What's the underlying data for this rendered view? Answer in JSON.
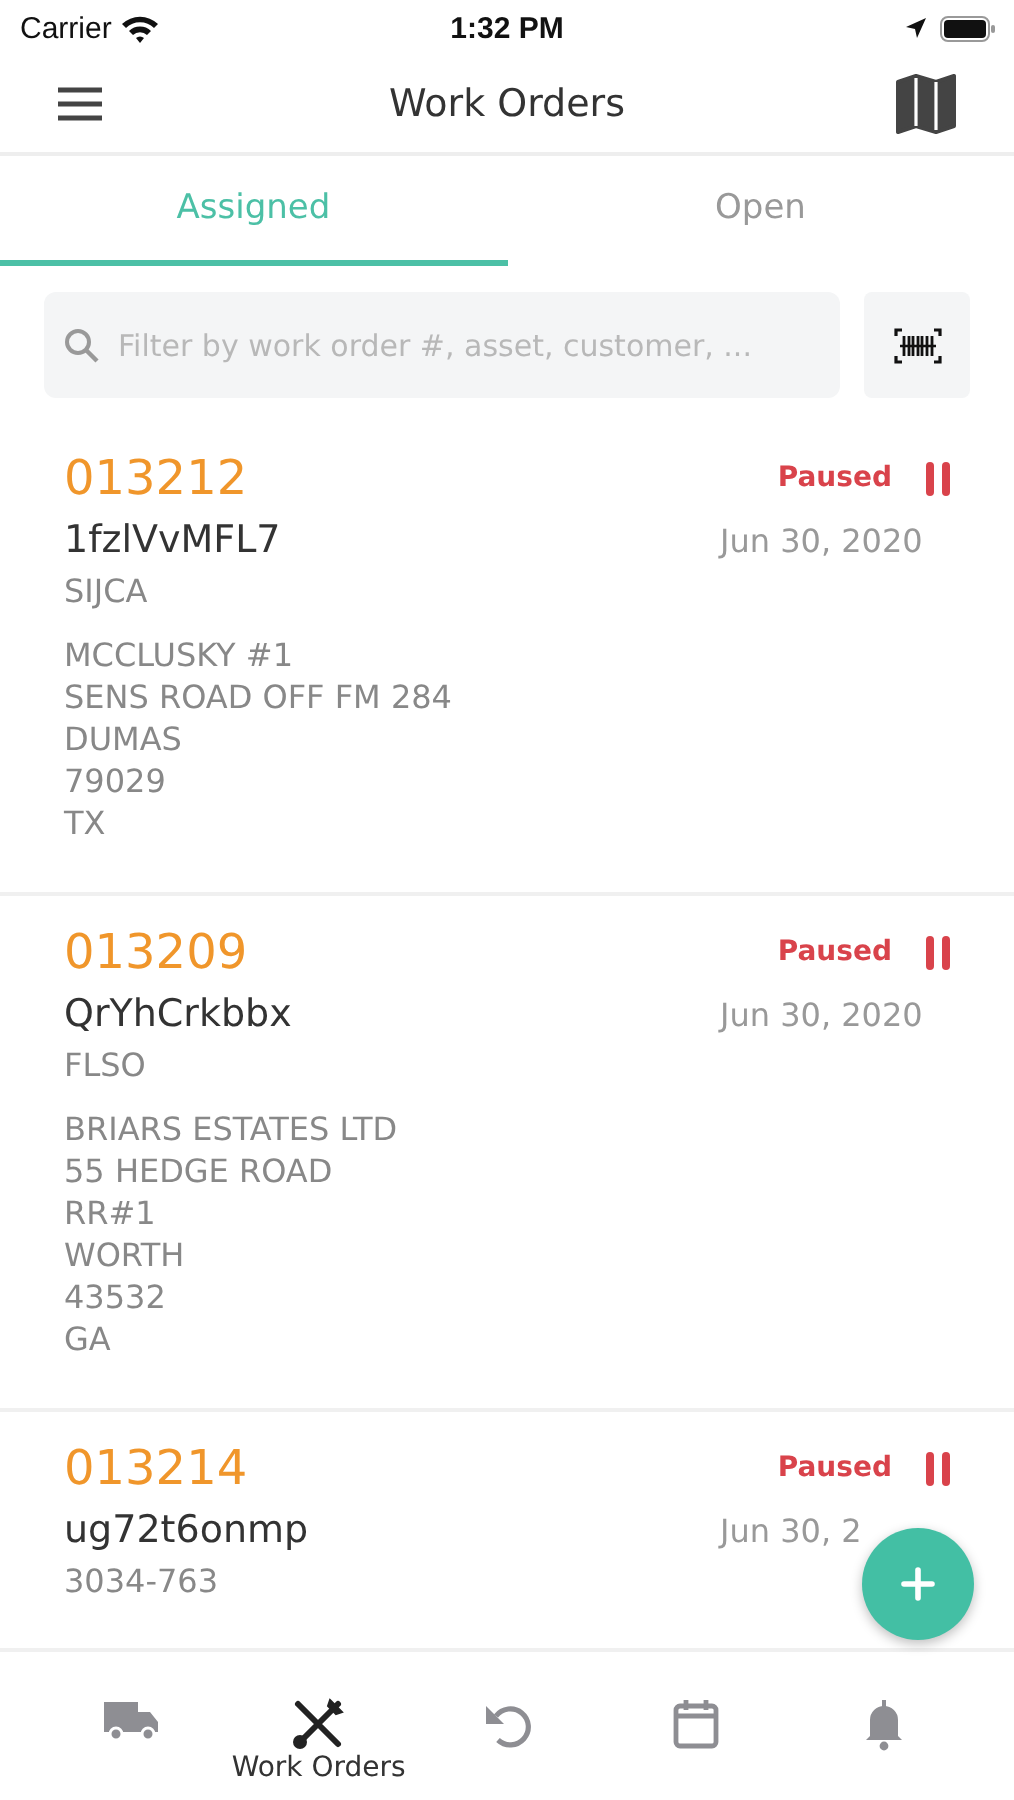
{
  "status_bar": {
    "carrier": "Carrier",
    "time": "1:32 PM"
  },
  "header": {
    "title": "Work Orders"
  },
  "tabs": [
    {
      "label": "Assigned",
      "selected": true
    },
    {
      "label": "Open",
      "selected": false
    }
  ],
  "search": {
    "placeholder": "Filter by work order #, asset, customer, ..."
  },
  "orders": [
    {
      "number": "013212",
      "status": "Paused",
      "paused": true,
      "asset": "1fzlVvMFL7",
      "date": "Jun 30, 2020",
      "customer": "SIJCA",
      "address": [
        "MCCLUSKY #1",
        "SENS ROAD OFF FM 284",
        "DUMAS",
        "79029",
        "TX"
      ]
    },
    {
      "number": "013209",
      "status": "Paused",
      "paused": true,
      "asset": "QrYhCrkbbx",
      "date": "Jun 30, 2020",
      "customer": "FLSO",
      "address": [
        "BRIARS ESTATES LTD",
        "55 HEDGE ROAD",
        "RR#1",
        "WORTH",
        "43532",
        "GA"
      ]
    },
    {
      "number": "013214",
      "status": "Paused",
      "paused": true,
      "asset": "ug72t6onmp",
      "date": "Jun 30, 2",
      "customer": "3034-763"
    }
  ],
  "nav": [
    {
      "kind": "truck",
      "selected": false
    },
    {
      "kind": "tools",
      "label": "Work Orders",
      "selected": true
    },
    {
      "kind": "undo",
      "selected": false
    },
    {
      "kind": "calendar",
      "selected": false
    },
    {
      "kind": "bell",
      "selected": false
    }
  ]
}
